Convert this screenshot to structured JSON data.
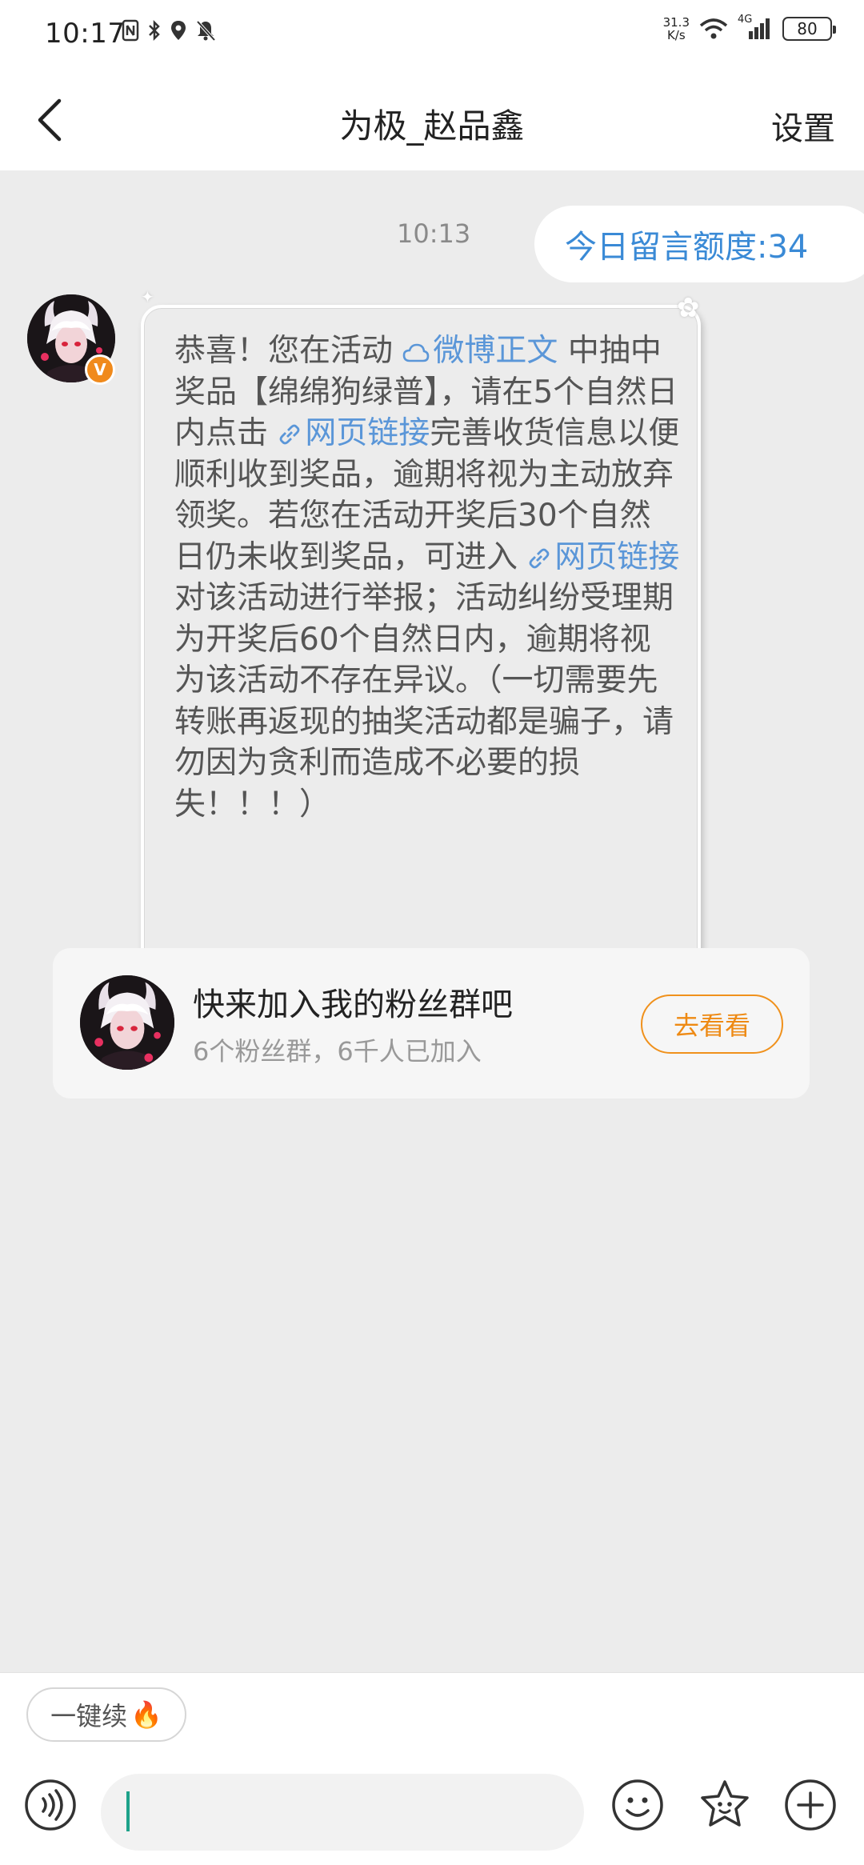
{
  "status_bar": {
    "time": "10:17",
    "net_speed_value": "31.3",
    "net_speed_unit": "K/s",
    "network_type": "4G",
    "battery": "80"
  },
  "nav": {
    "title": "为极_赵品鑫",
    "settings_label": "设置"
  },
  "chat": {
    "timestamp": "10:13",
    "quota_text": "今日留言额度:34",
    "message": {
      "part1": "恭喜！您在活动 ",
      "activity_link": "微博正文",
      "part2": " 中抽中奖品【绵绵狗绿普】，请在5个自然日内点击 ",
      "link1": "网页链接",
      "part3": "完善收货信息以便顺利收到奖品，逾期将视为主动放弃领奖。若您在活动开奖后30个自然日仍未收到奖品，可进入 ",
      "link2": "网页链接",
      "part4": "对该活动进行举报；活动纠纷受理期为开奖后60个自然日内，逾期将视为该活动不存在异议。（一切需要先转账再返现的抽奖活动都是骗子，请勿因为贪利而造成不必要的损失！！！）"
    },
    "verified_badge": "V"
  },
  "fan_card": {
    "title": "快来加入我的粉丝群吧",
    "subtitle": "6个粉丝群，6千人已加入",
    "button_label": "去看看"
  },
  "input": {
    "quick_chip_label": "一键续",
    "quick_chip_emoji": "🔥"
  },
  "icons": [
    "back-arrow-icon",
    "wifi-icon",
    "signal-icon",
    "voice-icon",
    "emoji-icon",
    "sticker-icon",
    "plus-icon"
  ],
  "colors": {
    "link": "#5a96d8",
    "quota_text": "#3a8ad6",
    "accent_orange": "#f0911c",
    "chat_bg": "#ececec"
  }
}
